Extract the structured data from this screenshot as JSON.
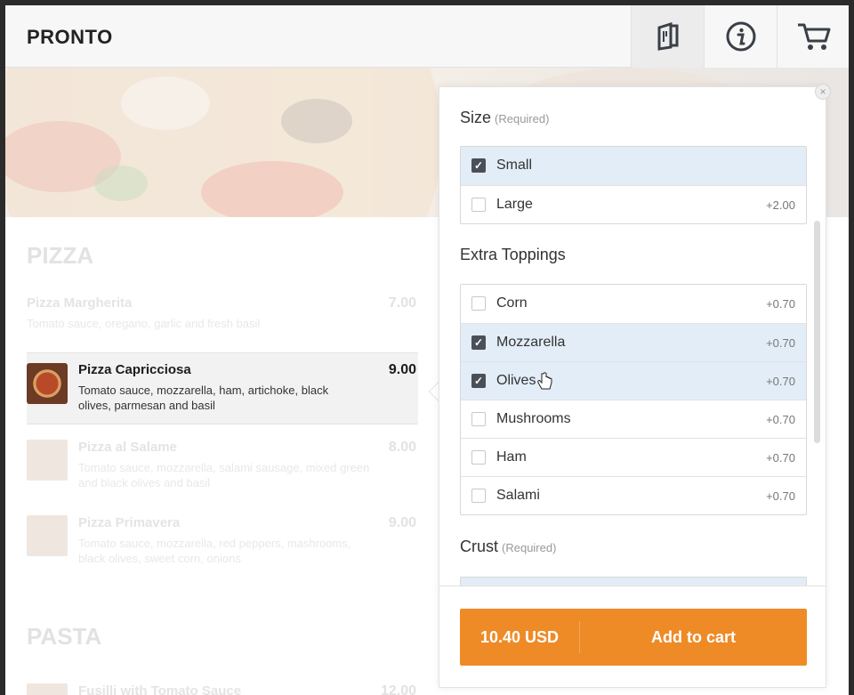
{
  "header": {
    "brand": "PRONTO",
    "icons": [
      "menu-book-icon",
      "info-icon",
      "cart-icon"
    ]
  },
  "menu": {
    "categories": [
      {
        "title": "PIZZA"
      },
      {
        "title": "PASTA"
      }
    ],
    "items": [
      {
        "name": "Pizza Margherita",
        "desc": "Tomato sauce, oregano, garlic and fresh basil",
        "price": "7.00"
      },
      {
        "name": "Pizza Capricciosa",
        "desc": "Tomato sauce, mozzarella, ham, artichoke, black olives, parmesan and basil",
        "price": "9.00"
      },
      {
        "name": "Pizza al Salame",
        "desc": "Tomato sauce, mozzarella, salami sausage, mixed green and black olives and basil",
        "price": "8.00"
      },
      {
        "name": "Pizza Primavera",
        "desc": "Tomato sauce, mozzarella, red peppers, mashrooms, black olives, sweet corn, onions",
        "price": "9.00"
      },
      {
        "name": "Fusilli with Tomato Sauce",
        "desc": "",
        "price": "12.00"
      }
    ]
  },
  "panel": {
    "size": {
      "title": "Size",
      "required": "(Required)",
      "options": [
        {
          "label": "Small",
          "price": "",
          "checked": true
        },
        {
          "label": "Large",
          "price": "+2.00",
          "checked": false
        }
      ]
    },
    "toppings": {
      "title": "Extra Toppings",
      "options": [
        {
          "label": "Corn",
          "price": "+0.70",
          "checked": false
        },
        {
          "label": "Mozzarella",
          "price": "+0.70",
          "checked": true
        },
        {
          "label": "Olives",
          "price": "+0.70",
          "checked": true
        },
        {
          "label": "Mushrooms",
          "price": "+0.70",
          "checked": false
        },
        {
          "label": "Ham",
          "price": "+0.70",
          "checked": false
        },
        {
          "label": "Salami",
          "price": "+0.70",
          "checked": false
        }
      ]
    },
    "crust": {
      "title": "Crust",
      "required": "(Required)"
    },
    "footer": {
      "total": "10.40 USD",
      "add_label": "Add to cart"
    },
    "close_glyph": "×"
  },
  "colors": {
    "accent": "#ee8b27",
    "selected_row": "#e2edf7",
    "checkbox_checked": "#4a4f58"
  }
}
